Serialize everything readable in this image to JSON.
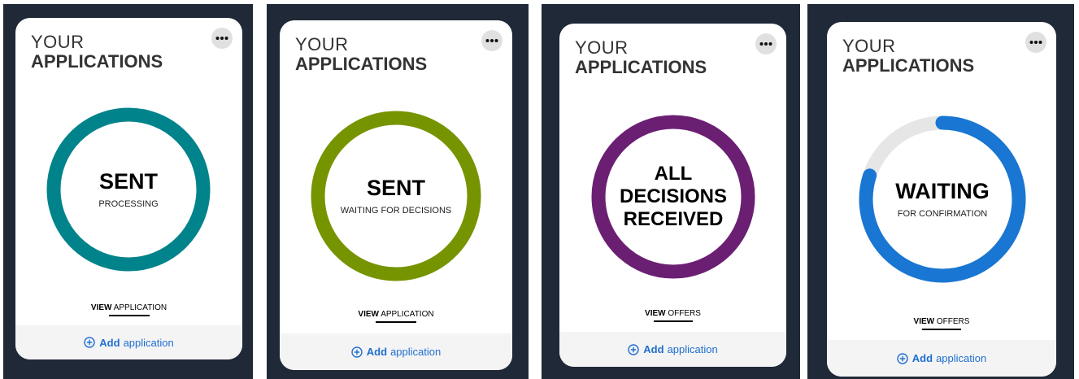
{
  "cards": [
    {
      "title_line1": "YOUR",
      "title_line2": "APPLICATIONS",
      "status": "SENT",
      "subtitle": "PROCESSING",
      "ring_color": "#00838a",
      "progress": 1.0,
      "view_bold": "VIEW",
      "view_rest": "APPLICATION",
      "footer_bold": "Add",
      "footer_rest": "application"
    },
    {
      "title_line1": "YOUR",
      "title_line2": "APPLICATIONS",
      "status": "SENT",
      "subtitle": "WAITING FOR DECISIONS",
      "ring_color": "#759400",
      "progress": 1.0,
      "view_bold": "VIEW",
      "view_rest": "APPLICATION",
      "footer_bold": "Add",
      "footer_rest": "application"
    },
    {
      "title_line1": "YOUR",
      "title_line2": "APPLICATIONS",
      "status_lines": [
        "ALL",
        "DECISIONS",
        "RECEIVED"
      ],
      "ring_color": "#6b1f73",
      "progress": 1.0,
      "view_bold": "VIEW",
      "view_rest": "OFFERS",
      "footer_bold": "Add",
      "footer_rest": "application"
    },
    {
      "title_line1": "YOUR",
      "title_line2": "APPLICATIONS",
      "status": "WAITING",
      "subtitle": "FOR CONFIRMATION",
      "ring_color": "#1976d2",
      "ring_track_color": "#e6e6e6",
      "progress": 0.8,
      "view_bold": "VIEW",
      "view_rest": "OFFERS",
      "footer_bold": "Add",
      "footer_rest": "application"
    }
  ],
  "colors": {
    "panel_bg": "#1f2937",
    "card_bg": "#ffffff",
    "footer_bg": "#f4f4f5",
    "link_blue": "#1f6fcf"
  },
  "icons": {
    "more": "more-horizontal-icon",
    "add": "plus-circle-icon"
  }
}
